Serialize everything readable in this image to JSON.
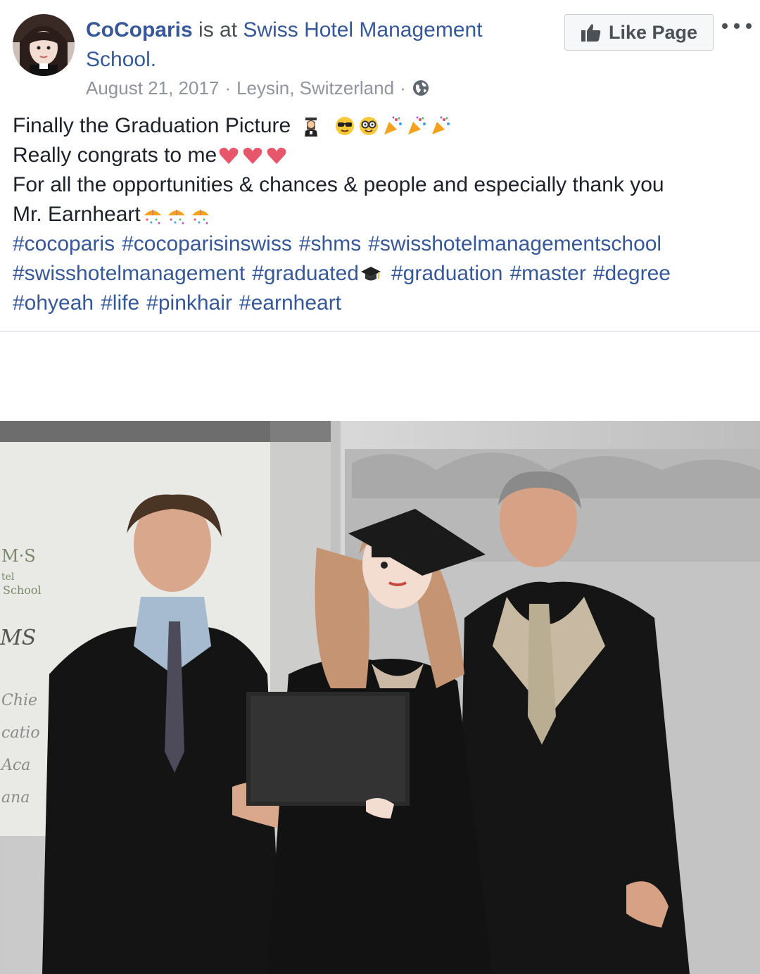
{
  "post": {
    "author": "CoCoparis",
    "is_at": " is at ",
    "place": "Swiss Hotel Management School.",
    "date": "August 21, 2017",
    "sep": "·",
    "location": "Leysin, Switzerland",
    "like_button": "Like Page",
    "icons": {
      "like": "thumbs-up-icon",
      "more": "more-options-icon",
      "privacy": "globe-icon"
    },
    "message": {
      "line1": "Finally the Graduation Picture",
      "line2": "Really congrats to me",
      "line3": "For all the opportunities & chances & people and especially thank you",
      "line4": "Mr. Earnheart"
    },
    "hashtags": {
      "row1": [
        "#cocoparis",
        "#cocoparisinswiss",
        "#shms",
        "#swisshotelmanagementschool"
      ],
      "row2a": "#swisshotelmanagement",
      "row2b": "#graduated",
      "row2c": [
        "#graduation",
        "#master",
        "#degree"
      ],
      "row3": [
        "#ohyeah",
        "#life",
        "#pinkhair",
        "#earnheart"
      ]
    },
    "photo": {
      "banner_text_1": "M·S",
      "banner_text_2": "tel",
      "banner_text_3": "School",
      "banner_text_4": "MS",
      "banner_text_5": "Chie",
      "banner_text_6": "catio",
      "banner_text_7": "Aca",
      "banner_text_8": "ana"
    }
  }
}
